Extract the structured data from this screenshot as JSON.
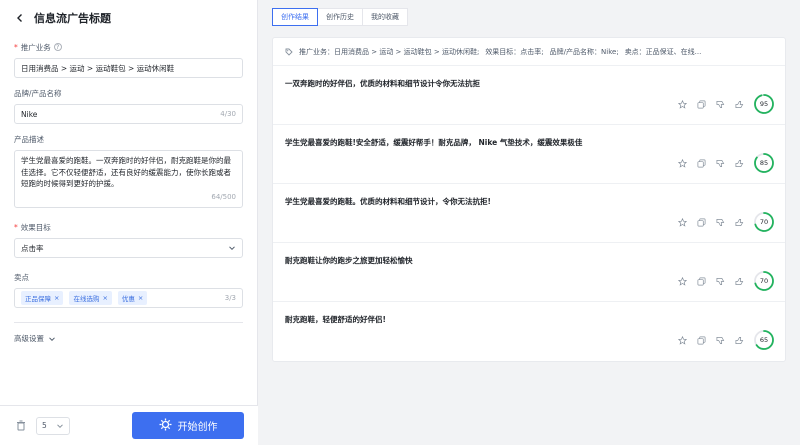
{
  "header": {
    "title": "信息流广告标题"
  },
  "form": {
    "business": {
      "label": "推广业务",
      "value": "日用消费品 > 运动 > 运动鞋包 > 运动休闲鞋"
    },
    "brand": {
      "label": "品牌/产品名称",
      "value": "Nike",
      "counter": "4/30"
    },
    "description": {
      "label": "产品描述",
      "value": "学生党最喜爱的跑鞋。一双奔跑时的好伴侣，耐克跑鞋是你的最佳选择。它不仅轻便舒适，还有良好的缓震能力，使你长跑或者短跑的时候得到更好的护援。",
      "counter": "64/500"
    },
    "goal": {
      "label": "效果目标",
      "value": "点击率"
    },
    "selling_points": {
      "label": "卖点",
      "tags": [
        "正品保障",
        "在线选购",
        "优惠"
      ],
      "counter": "3/3"
    },
    "advanced_label": "高级设置"
  },
  "footer": {
    "count_value": "5",
    "start_label": "开始创作"
  },
  "tabs": [
    "创作结果",
    "创作历史",
    "我的收藏"
  ],
  "summary": [
    "推广业务：日用消费品 > 运动 > 运动鞋包 > 运动休闲鞋;",
    "效果目标：点击率;",
    "品牌/产品名称：Nike;",
    "卖点：正品保证、在线..."
  ],
  "results": [
    {
      "text": "一双奔跑时的好伴侣，优质的材料和细节设计令你无法抗拒",
      "score": 95
    },
    {
      "text": "学生党最喜爱的跑鞋!安全舒适，缓震好帮手！耐克品牌， Nike 气垫技术，缓震效果极佳",
      "score": 85
    },
    {
      "text": "学生党最喜爱的跑鞋。优质的材料和细节设计，令你无法抗拒!",
      "score": 70
    },
    {
      "text": "耐克跑鞋让你的跑步之旅更加轻松愉快",
      "score": 70
    },
    {
      "text": "耐克跑鞋，轻便舒适的好伴侣!",
      "score": 65
    }
  ],
  "colors": {
    "accent": "#3d6ff0",
    "score_ring": "#22b35e",
    "required": "#f53f3f"
  }
}
